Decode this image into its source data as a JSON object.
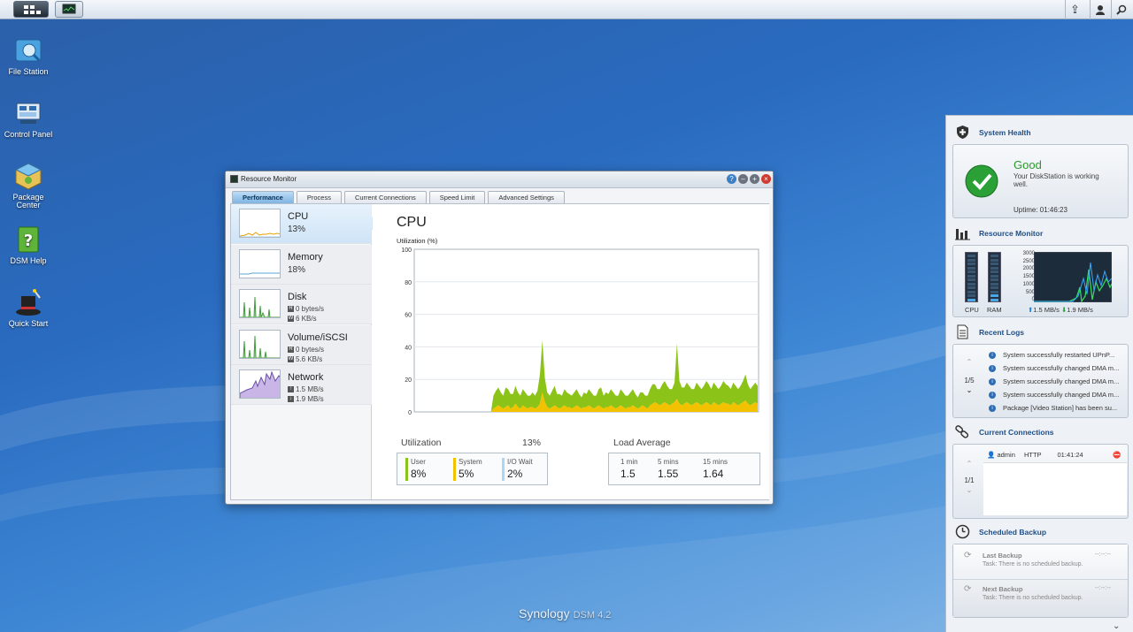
{
  "taskbar": {
    "main_menu": "main-menu",
    "open_app": "resource-monitor"
  },
  "desktop": {
    "icons": [
      {
        "label": "File Station"
      },
      {
        "label": "Control Panel"
      },
      {
        "label": "Package Center"
      },
      {
        "label": "DSM Help"
      },
      {
        "label": "Quick Start"
      }
    ]
  },
  "window": {
    "title": "Resource Monitor",
    "tabs": [
      {
        "label": "Performance",
        "active": true
      },
      {
        "label": "Process"
      },
      {
        "label": "Current Connections"
      },
      {
        "label": "Speed Limit"
      },
      {
        "label": "Advanced Settings"
      }
    ],
    "sidebar": {
      "cpu": {
        "name": "CPU",
        "value": "13%"
      },
      "memory": {
        "name": "Memory",
        "value": "18%"
      },
      "disk": {
        "name": "Disk",
        "read": "0 bytes/s",
        "write": "6 KB/s"
      },
      "volume": {
        "name": "Volume/iSCSI",
        "read": "0 bytes/s",
        "write": "5.6 KB/s"
      },
      "network": {
        "name": "Network",
        "up": "1.5 MB/s",
        "down": "1.9 MB/s"
      },
      "read_badge": "R",
      "write_badge": "W"
    },
    "main": {
      "title": "CPU",
      "util_axis_label": "Utilization (%)",
      "utilization_label": "Utilization",
      "utilization_value": "13%",
      "user_label": "User",
      "user_value": "8%",
      "system_label": "System",
      "system_value": "5%",
      "iowait_label": "I/O Wait",
      "iowait_value": "2%",
      "load_label": "Load Average",
      "load_1_label": "1 min",
      "load_1_value": "1.5",
      "load_5_label": "5 mins",
      "load_5_value": "1.55",
      "load_15_label": "15 mins",
      "load_15_value": "1.64"
    },
    "colors": {
      "user": "#8cc319",
      "system": "#f2c200",
      "iowait": "#a9d8f2"
    }
  },
  "chart_data": {
    "type": "area",
    "ylabel": "Utilization (%)",
    "ylim": [
      0,
      100
    ],
    "yticks": [
      0,
      20,
      40,
      60,
      80,
      100
    ],
    "grid": true,
    "series": [
      {
        "name": "System",
        "values": [
          0,
          0,
          0,
          0,
          0,
          0,
          0,
          0,
          0,
          0,
          0,
          0,
          0,
          0,
          0,
          0,
          0,
          0,
          0,
          0,
          0,
          0,
          0,
          0,
          0,
          0,
          0,
          0,
          0,
          0,
          0,
          0,
          2,
          3,
          4,
          3,
          2,
          3,
          4,
          2,
          3,
          5,
          3,
          2,
          4,
          3,
          2,
          3,
          3,
          2,
          3,
          5,
          12,
          6,
          3,
          2,
          3,
          4,
          3,
          2,
          3,
          4,
          3,
          3,
          2,
          3,
          4,
          3,
          2,
          3,
          3,
          4,
          3,
          2,
          3,
          4,
          3,
          2,
          3,
          3,
          4,
          3,
          2,
          3,
          4,
          3,
          2,
          3,
          3,
          4,
          3,
          2,
          3,
          4,
          3,
          2,
          4,
          5,
          6,
          5,
          4,
          5,
          6,
          5,
          4,
          5,
          6,
          8,
          5,
          4,
          5,
          6,
          5,
          4,
          5,
          6,
          5,
          4,
          5,
          6,
          5,
          4,
          6,
          5,
          4,
          5,
          6,
          5,
          5,
          4,
          6,
          5,
          4,
          5,
          6,
          7,
          5,
          4,
          5,
          6,
          5
        ]
      },
      {
        "name": "User",
        "values": [
          0,
          0,
          0,
          0,
          0,
          0,
          0,
          0,
          0,
          0,
          0,
          0,
          0,
          0,
          0,
          0,
          0,
          0,
          0,
          0,
          0,
          0,
          0,
          0,
          0,
          0,
          0,
          0,
          0,
          0,
          0,
          0,
          8,
          10,
          11,
          9,
          8,
          12,
          10,
          9,
          8,
          11,
          9,
          8,
          10,
          9,
          8,
          7,
          9,
          8,
          10,
          18,
          32,
          15,
          9,
          8,
          10,
          12,
          8,
          9,
          7,
          10,
          9,
          8,
          8,
          9,
          10,
          8,
          7,
          9,
          8,
          10,
          9,
          8,
          7,
          10,
          12,
          8,
          9,
          8,
          10,
          9,
          8,
          7,
          10,
          9,
          8,
          7,
          9,
          10,
          8,
          7,
          9,
          8,
          7,
          8,
          10,
          12,
          11,
          9,
          10,
          12,
          13,
          11,
          10,
          9,
          12,
          34,
          14,
          11,
          10,
          12,
          11,
          10,
          9,
          12,
          11,
          10,
          11,
          13,
          12,
          10,
          12,
          11,
          10,
          11,
          13,
          12,
          11,
          10,
          12,
          11,
          10,
          11,
          13,
          16,
          12,
          10,
          11,
          12,
          11
        ]
      }
    ]
  },
  "panel": {
    "health": {
      "title": "System Health",
      "status": "Good",
      "message": "Your DiskStation is working well.",
      "uptime": "Uptime: 01:46:23"
    },
    "resource": {
      "title": "Resource Monitor",
      "cpu_label": "CPU",
      "ram_label": "RAM",
      "cpu_level": 0.15,
      "ram_level": 0.18,
      "yticks": [
        "3000",
        "2500",
        "2000",
        "1500",
        "1000",
        "500",
        "0"
      ],
      "up": "1.5 MB/s",
      "down": "1.9 MB/s"
    },
    "logs": {
      "title": "Recent Logs",
      "page": "1/5",
      "rows": [
        "System successfully restarted UPnP...",
        "System successfully changed DMA m...",
        "System successfully changed DMA m...",
        "System successfully changed DMA m...",
        "Package [Video Station] has been su..."
      ]
    },
    "connections": {
      "title": "Current Connections",
      "page": "1/1",
      "user": "admin",
      "type": "HTTP",
      "time": "01:41:24"
    },
    "backup": {
      "title": "Scheduled Backup",
      "last_title": "Last Backup",
      "last_task": "Task: There is no scheduled backup.",
      "last_time": "--:--:--",
      "next_title": "Next Backup",
      "next_task": "Task: There is no scheduled backup.",
      "next_time": "--:--:--"
    }
  },
  "brand": {
    "name": "Synology",
    "version": "DSM 4.2"
  }
}
